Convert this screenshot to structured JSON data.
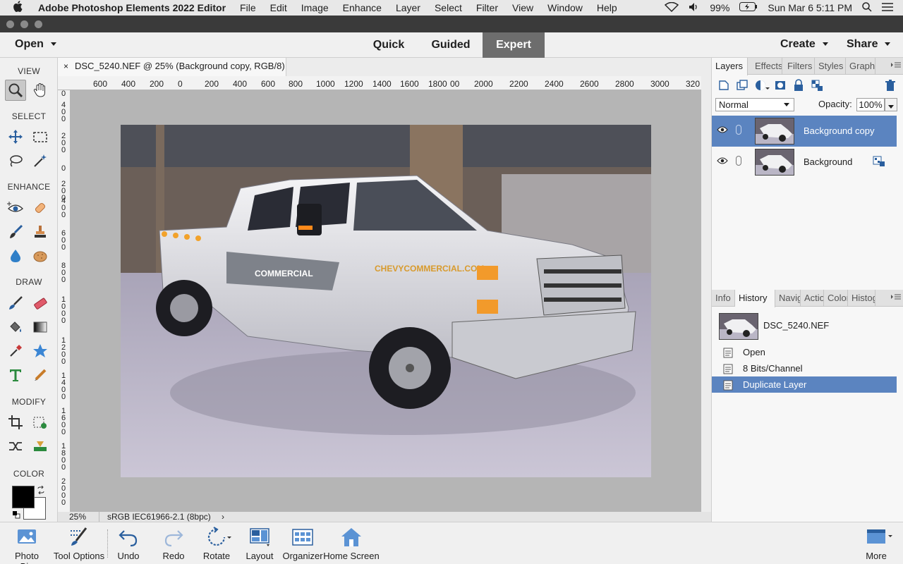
{
  "menubar": {
    "app_name": "Adobe Photoshop Elements 2022 Editor",
    "items": [
      "File",
      "Edit",
      "Image",
      "Enhance",
      "Layer",
      "Select",
      "Filter",
      "View",
      "Window",
      "Help"
    ],
    "battery": "99%",
    "datetime": "Sun Mar 6  5:11 PM"
  },
  "topbar": {
    "open_label": "Open",
    "modes": [
      "Quick",
      "Guided",
      "Expert"
    ],
    "active_mode": "Expert",
    "create_label": "Create",
    "share_label": "Share"
  },
  "toolbox": {
    "sections": {
      "view": "VIEW",
      "select": "SELECT",
      "enhance": "ENHANCE",
      "draw": "DRAW",
      "modify": "MODIFY",
      "color": "COLOR"
    }
  },
  "document": {
    "tab_title": "DSC_5240.NEF @ 25% (Background copy, RGB/8) *",
    "close": "×",
    "ruler_h": [
      "600",
      "400",
      "200",
      "0",
      "200",
      "400",
      "600",
      "800",
      "1000",
      "1200",
      "1400",
      "1600",
      "1800",
      "00",
      "2000",
      "2200",
      "2400",
      "2600",
      "2800",
      "3000",
      "320"
    ],
    "ruler_v": [
      "0",
      "400",
      "200",
      "0",
      "200",
      "400",
      "600",
      "800",
      "1000",
      "1200",
      "1400",
      "1600",
      "1800",
      "2000"
    ],
    "zoom": "25%",
    "color_profile": "sRGB IEC61966-2.1 (8bpc)",
    "status_arrow": "›"
  },
  "layers_panel": {
    "tabs": [
      "Layers",
      "Effects",
      "Filters",
      "Styles",
      "Graphics"
    ],
    "active_tab": "Layers",
    "blend_mode": "Normal",
    "opacity_label": "Opacity:",
    "opacity_value": "100%",
    "layers": [
      {
        "name": "Background copy",
        "selected": true
      },
      {
        "name": "Background",
        "selected": false
      }
    ]
  },
  "history_panel": {
    "tabs": [
      "Info",
      "History",
      "Navigator",
      "Actions",
      "Color",
      "Histogram"
    ],
    "active_tab": "History",
    "snapshot_name": "DSC_5240.NEF",
    "steps": [
      {
        "label": "Open",
        "selected": false
      },
      {
        "label": "8 Bits/Channel",
        "selected": false
      },
      {
        "label": "Duplicate Layer",
        "selected": true
      }
    ]
  },
  "bottombar": {
    "items": [
      "Photo Bin",
      "Tool Options",
      "Undo",
      "Redo",
      "Rotate",
      "Layout",
      "Organizer",
      "Home Screen"
    ],
    "more_label": "More"
  },
  "colors": {
    "selection_blue": "#5b84c0",
    "active_mode_bg": "#6d6d6d",
    "canvas_bg": "#b5b5b5"
  }
}
